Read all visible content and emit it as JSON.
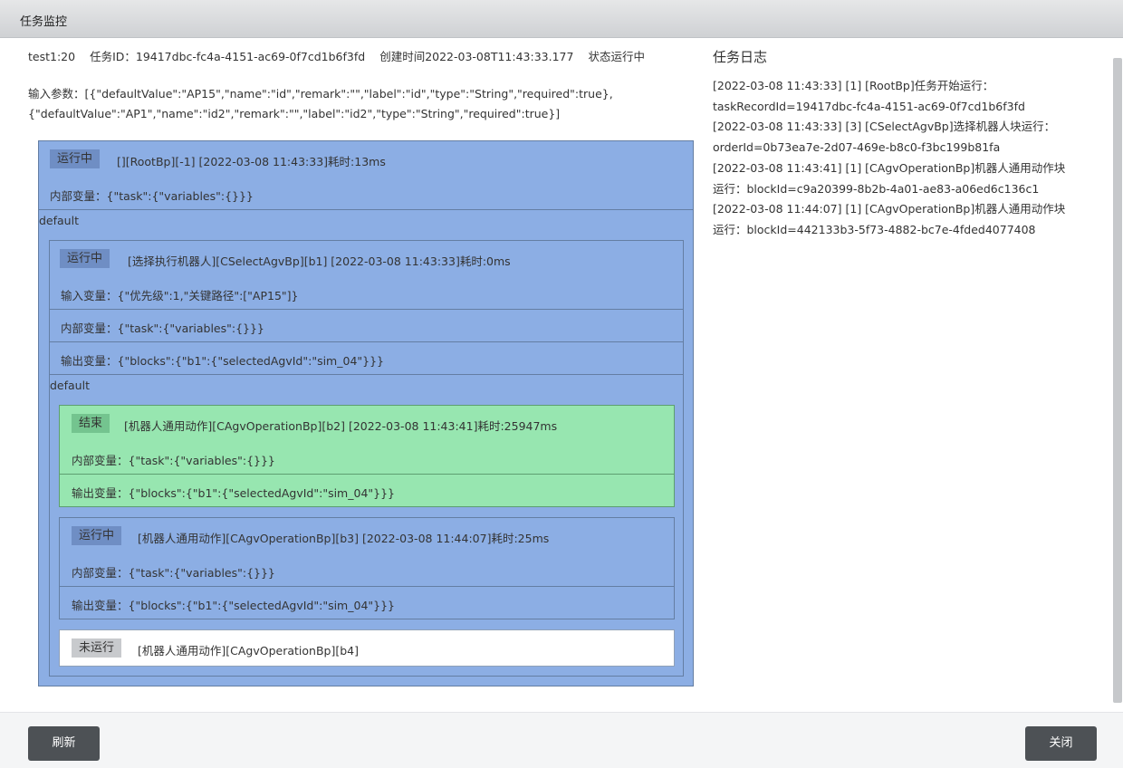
{
  "window": {
    "title": "任务监控"
  },
  "task": {
    "name": "test1:20",
    "id_text": "任务ID：19417dbc-fc4a-4151-ac69-0f7cd1b6f3fd",
    "created_text": "创建时间2022-03-08T11:43:33.177",
    "status_text": "状态运行中",
    "params_line1": "输入参数：[{\"defaultValue\":\"AP15\",\"name\":\"id\",\"remark\":\"\",\"label\":\"id\",\"type\":\"String\",\"required\":true},",
    "params_line2": "{\"defaultValue\":\"AP1\",\"name\":\"id2\",\"remark\":\"\",\"label\":\"id2\",\"type\":\"String\",\"required\":true}]"
  },
  "blocks": {
    "root": {
      "status": "运行中",
      "header": "[][RootBp][-1] [2022-03-08 11:43:33]耗时:13ms",
      "internal": "内部变量：{\"task\":{\"variables\":{}}}",
      "branch": "default"
    },
    "b1": {
      "status": "运行中",
      "header": "[选择执行机器人][CSelectAgvBp][b1] [2022-03-08 11:43:33]耗时:0ms",
      "input": "输入变量：{\"优先级\":1,\"关键路径\":[\"AP15\"]}",
      "internal": "内部变量：{\"task\":{\"variables\":{}}}",
      "output": "输出变量：{\"blocks\":{\"b1\":{\"selectedAgvId\":\"sim_04\"}}}",
      "branch": "default"
    },
    "b2": {
      "status": "结束",
      "header": "[机器人通用动作][CAgvOperationBp][b2] [2022-03-08 11:43:41]耗时:25947ms",
      "internal": "内部变量：{\"task\":{\"variables\":{}}}",
      "output": "输出变量：{\"blocks\":{\"b1\":{\"selectedAgvId\":\"sim_04\"}}}"
    },
    "b3": {
      "status": "运行中",
      "header": "[机器人通用动作][CAgvOperationBp][b3] [2022-03-08 11:44:07]耗时:25ms",
      "internal": "内部变量：{\"task\":{\"variables\":{}}}",
      "output": "输出变量：{\"blocks\":{\"b1\":{\"selectedAgvId\":\"sim_04\"}}}"
    },
    "b4": {
      "status": "未运行",
      "header": "[机器人通用动作][CAgvOperationBp][b4]"
    }
  },
  "log": {
    "title": "任务日志",
    "lines": [
      "[2022-03-08 11:43:33] [1] [RootBp]任务开始运行：",
      "taskRecordId=19417dbc-fc4a-4151-ac69-0f7cd1b6f3fd",
      "[2022-03-08 11:43:33] [3] [CSelectAgvBp]选择机器人块运行：",
      "orderId=0b73ea7e-2d07-469e-b8c0-f3bc199b81fa",
      "[2022-03-08 11:43:41] [1] [CAgvOperationBp]机器人通用动作块",
      "运行：blockId=c9a20399-8b2b-4a01-ae83-a06ed6c136c1",
      "[2022-03-08 11:44:07] [1] [CAgvOperationBp]机器人通用动作块",
      "运行：blockId=442133b3-5f73-4882-bc7e-4fded4077408"
    ]
  },
  "footer": {
    "refresh_label": "刷新",
    "close_label": "关闭"
  }
}
